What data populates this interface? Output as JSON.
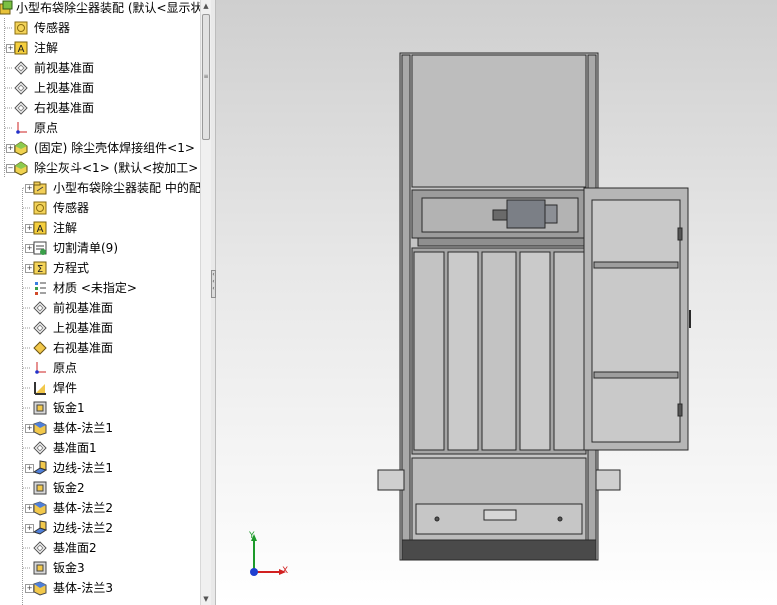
{
  "tree": {
    "items": [
      {
        "label": "小型布袋除尘器装配 (默认<显示状",
        "icon": "assembly-icon",
        "level": 0,
        "expander": "minus"
      },
      {
        "label": "传感器",
        "icon": "sensor-icon",
        "level": 1,
        "expander": ""
      },
      {
        "label": "注解",
        "icon": "annotation-icon",
        "level": 1,
        "expander": "plus"
      },
      {
        "label": "前视基准面",
        "icon": "plane-icon",
        "level": 1,
        "expander": ""
      },
      {
        "label": "上视基准面",
        "icon": "plane-icon",
        "level": 1,
        "expander": ""
      },
      {
        "label": "右视基准面",
        "icon": "plane-icon",
        "level": 1,
        "expander": ""
      },
      {
        "label": "原点",
        "icon": "origin-icon",
        "level": 1,
        "expander": ""
      },
      {
        "label": "(固定) 除尘壳体焊接组件<1>",
        "icon": "part-icon",
        "level": 1,
        "expander": "plus"
      },
      {
        "label": "除尘灰斗<1> (默认<按加工>",
        "icon": "part-icon",
        "level": 1,
        "expander": "minus"
      },
      {
        "label": "小型布袋除尘器装配 中的配",
        "icon": "mate-folder-icon",
        "level": 2,
        "expander": "plus"
      },
      {
        "label": "传感器",
        "icon": "sensor-icon",
        "level": 2,
        "expander": ""
      },
      {
        "label": "注解",
        "icon": "annotation-icon",
        "level": 2,
        "expander": "plus"
      },
      {
        "label": "切割清单(9)",
        "icon": "cut-list-icon",
        "level": 2,
        "expander": "plus"
      },
      {
        "label": "方程式",
        "icon": "equation-icon",
        "level": 2,
        "expander": "plus"
      },
      {
        "label": "材质 <未指定>",
        "icon": "material-icon",
        "level": 2,
        "expander": ""
      },
      {
        "label": "前视基准面",
        "icon": "plane-icon",
        "level": 2,
        "expander": ""
      },
      {
        "label": "上视基准面",
        "icon": "plane-icon",
        "level": 2,
        "expander": ""
      },
      {
        "label": "右视基准面",
        "icon": "plane-selected-icon",
        "level": 2,
        "expander": ""
      },
      {
        "label": "原点",
        "icon": "origin-icon",
        "level": 2,
        "expander": ""
      },
      {
        "label": "焊件",
        "icon": "weldment-icon",
        "level": 2,
        "expander": ""
      },
      {
        "label": "钣金1",
        "icon": "sheet-metal-icon",
        "level": 2,
        "expander": ""
      },
      {
        "label": "基体-法兰1",
        "icon": "base-flange-icon",
        "level": 2,
        "expander": "plus"
      },
      {
        "label": "基准面1",
        "icon": "plane-icon",
        "level": 2,
        "expander": ""
      },
      {
        "label": "边线-法兰1",
        "icon": "edge-flange-icon",
        "level": 2,
        "expander": "plus"
      },
      {
        "label": "钣金2",
        "icon": "sheet-metal-icon",
        "level": 2,
        "expander": ""
      },
      {
        "label": "基体-法兰2",
        "icon": "base-flange-icon",
        "level": 2,
        "expander": "plus"
      },
      {
        "label": "边线-法兰2",
        "icon": "edge-flange-icon",
        "level": 2,
        "expander": "plus"
      },
      {
        "label": "基准面2",
        "icon": "plane-icon",
        "level": 2,
        "expander": ""
      },
      {
        "label": "钣金3",
        "icon": "sheet-metal-icon",
        "level": 2,
        "expander": ""
      },
      {
        "label": "基体-法兰3",
        "icon": "base-flange-icon",
        "level": 2,
        "expander": "plus"
      }
    ]
  },
  "viewport": {
    "triad": {
      "x_label": "X",
      "y_label": "Y"
    }
  },
  "colors": {
    "tree_line": "#9b9b9b",
    "model_edge": "#2a2a2a",
    "model_fill": "#b9b9b9",
    "triad_x": "#d12020",
    "triad_y": "#1c9a2a",
    "triad_z": "#1f3fd0"
  }
}
